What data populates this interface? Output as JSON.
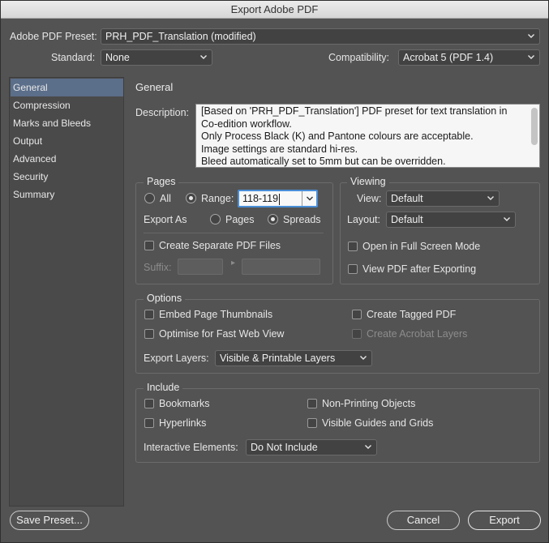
{
  "window": {
    "title": "Export Adobe PDF"
  },
  "top": {
    "preset_label": "Adobe PDF Preset:",
    "preset_value": "PRH_PDF_Translation (modified)",
    "standard_label": "Standard:",
    "standard_value": "None",
    "compat_label": "Compatibility:",
    "compat_value": "Acrobat 5 (PDF 1.4)"
  },
  "sidebar": {
    "items": [
      {
        "label": "General"
      },
      {
        "label": "Compression"
      },
      {
        "label": "Marks and Bleeds"
      },
      {
        "label": "Output"
      },
      {
        "label": "Advanced"
      },
      {
        "label": "Security"
      },
      {
        "label": "Summary"
      }
    ],
    "selected": "General"
  },
  "main": {
    "title": "General",
    "description_label": "Description:",
    "description_lines": [
      "[Based on 'PRH_PDF_Translation'] PDF preset for text translation in",
      "Co-edition workflow.",
      "Only Process Black (K) and Pantone colours are acceptable.",
      "Image settings are standard hi-res.",
      "Bleed automatically set to 5mm but can be overridden."
    ]
  },
  "pages": {
    "legend": "Pages",
    "all_label": "All",
    "range_label": "Range:",
    "range_value": "118-119",
    "export_as_label": "Export As",
    "pages_label": "Pages",
    "spreads_label": "Spreads",
    "separate_label": "Create Separate PDF Files",
    "suffix_label": "Suffix:"
  },
  "viewing": {
    "legend": "Viewing",
    "view_label": "View:",
    "view_value": "Default",
    "layout_label": "Layout:",
    "layout_value": "Default",
    "fullscreen_label": "Open in Full Screen Mode",
    "after_export_label": "View PDF after Exporting"
  },
  "options": {
    "legend": "Options",
    "thumbnails_label": "Embed Page Thumbnails",
    "fastweb_label": "Optimise for Fast Web View",
    "tagged_label": "Create Tagged PDF",
    "acrobat_layers_label": "Create Acrobat Layers",
    "export_layers_label": "Export Layers:",
    "export_layers_value": "Visible & Printable Layers"
  },
  "include": {
    "legend": "Include",
    "bookmarks_label": "Bookmarks",
    "hyperlinks_label": "Hyperlinks",
    "nonprinting_label": "Non-Printing Objects",
    "guides_label": "Visible Guides and Grids",
    "interactive_label": "Interactive Elements:",
    "interactive_value": "Do Not Include"
  },
  "buttons": {
    "save_preset": "Save Preset...",
    "cancel": "Cancel",
    "export": "Export"
  }
}
